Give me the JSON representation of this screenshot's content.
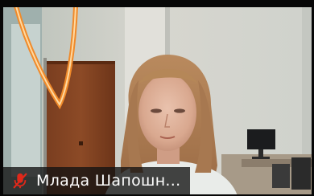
{
  "participant": {
    "name": "Млада Шапошн...",
    "mic_status": "muted",
    "mic_icon": "microphone-muted-icon"
  },
  "colors": {
    "mic_muted": "#e0281a",
    "name_text": "#ffffff",
    "name_bar_bg": "#121212",
    "frame_border": "#070707"
  }
}
